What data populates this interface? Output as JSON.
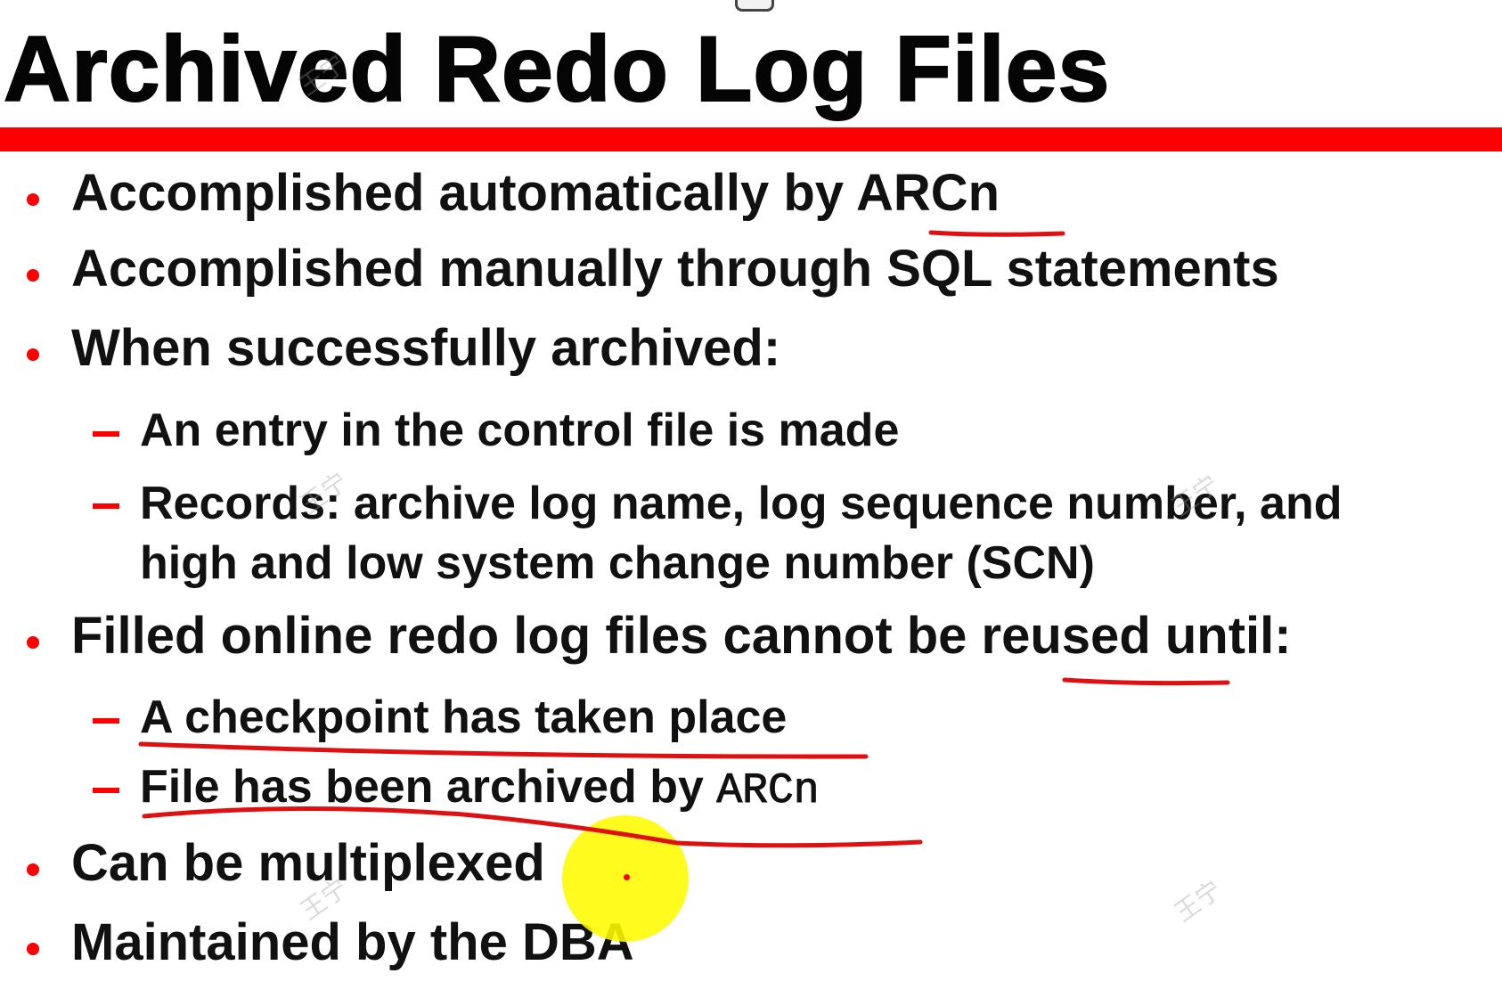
{
  "slide": {
    "title": "Archived Redo Log Files",
    "items": [
      {
        "level": 1,
        "text": "Accomplished automatically by ARCn"
      },
      {
        "level": 1,
        "text": "Accomplished manually through SQL statements"
      },
      {
        "level": 1,
        "text": "When successfully archived:"
      },
      {
        "level": 2,
        "text": "An entry in the control file is made"
      },
      {
        "level": 2,
        "text": "Records: archive log name, log sequence number, and"
      },
      {
        "level": 2,
        "text": "high and low system change number (SCN)"
      },
      {
        "level": 1,
        "text": "Filled online redo log files cannot be reused until:"
      },
      {
        "level": 2,
        "text": "A checkpoint has taken place"
      },
      {
        "level": 2,
        "text": "File has been archived by ",
        "code": "ARCn"
      },
      {
        "level": 1,
        "text": "Can be multiplexed"
      },
      {
        "level": 1,
        "text": "Maintained by the DBA"
      }
    ]
  },
  "colors": {
    "accent": "#ff0000",
    "text": "#111111",
    "pointer_highlight": "#fff800"
  }
}
